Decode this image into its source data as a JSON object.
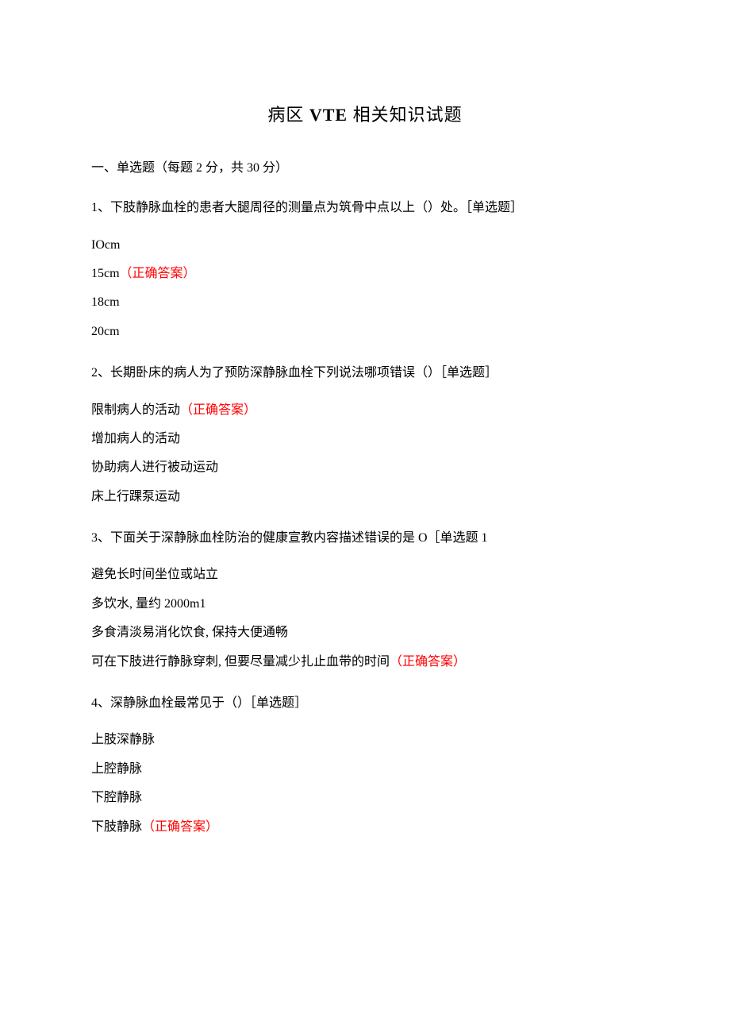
{
  "title_prefix": "病区 ",
  "title_bold": "VTE",
  "title_suffix": " 相关知识试题",
  "section_header": "一、单选题（每题 2 分，共 30 分）",
  "questions": [
    {
      "text": "1、下肢静脉血栓的患者大腿周径的测量点为筑骨中点以上（）处。［单选题］",
      "options": [
        {
          "text": "IOcm",
          "correct": false,
          "label": ""
        },
        {
          "text": "15cm",
          "correct": true,
          "label": "（正确答案）"
        },
        {
          "text": "18cm",
          "correct": false,
          "label": ""
        },
        {
          "text": "20cm",
          "correct": false,
          "label": ""
        }
      ]
    },
    {
      "text": "2、长期卧床的病人为了预防深静脉血栓下列说法哪项错误（）［单选题］",
      "options": [
        {
          "text": "限制病人的活动",
          "correct": true,
          "label": "（正确答案）"
        },
        {
          "text": "增加病人的活动",
          "correct": false,
          "label": ""
        },
        {
          "text": "协助病人进行被动运动",
          "correct": false,
          "label": ""
        },
        {
          "text": "床上行踝泵运动",
          "correct": false,
          "label": ""
        }
      ]
    },
    {
      "text": "3、下面关于深静脉血栓防治的健康宣教内容描述错误的是 O［单选题 1",
      "options": [
        {
          "text": "避免长时间坐位或站立",
          "correct": false,
          "label": ""
        },
        {
          "text": "多饮水, 量约 2000m1",
          "correct": false,
          "label": ""
        },
        {
          "text": "多食清淡易消化饮食, 保持大便通畅",
          "correct": false,
          "label": ""
        },
        {
          "text": "可在下肢进行静脉穿刺, 但要尽量减少扎止血带的时间",
          "correct": true,
          "label": "（正确答案）"
        }
      ]
    },
    {
      "text": "4、深静脉血栓最常见于（）［单选题］",
      "options": [
        {
          "text": "上肢深静脉",
          "correct": false,
          "label": ""
        },
        {
          "text": "上腔静脉",
          "correct": false,
          "label": ""
        },
        {
          "text": "下腔静脉",
          "correct": false,
          "label": ""
        },
        {
          "text": "下肢静脉",
          "correct": true,
          "label": "（正确答案）"
        }
      ]
    }
  ]
}
